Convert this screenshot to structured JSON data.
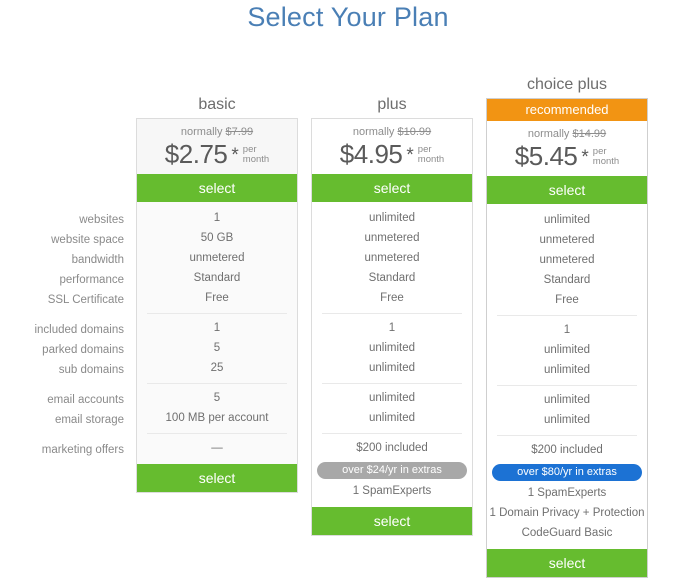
{
  "page": {
    "title": "Select Your Plan",
    "title_color": "#4a7fb5",
    "accent_green": "#66bc2f",
    "accent_orange": "#f29413",
    "accent_blue": "#1c72d4",
    "pill_gray": "#a8a8a8"
  },
  "feature_labels": {
    "group1": [
      "websites",
      "website space",
      "bandwidth",
      "performance",
      "SSL Certificate"
    ],
    "group2": [
      "included domains",
      "parked domains",
      "sub domains"
    ],
    "group3": [
      "email accounts",
      "email storage"
    ],
    "group4": [
      "marketing offers"
    ]
  },
  "plans": [
    {
      "name": "basic",
      "recommended_label": "",
      "is_recommended": false,
      "normally_prefix": "normally",
      "normally_price": "$7.99",
      "price": "$2.75",
      "star": "*",
      "per": "per",
      "month": "month",
      "select_label": "select",
      "values_group1": [
        "1",
        "50 GB",
        "unmetered",
        "Standard",
        "Free"
      ],
      "values_group2": [
        "1",
        "5",
        "25"
      ],
      "values_group3": [
        "5",
        "100 MB per account"
      ],
      "values_group4": [
        "—"
      ],
      "extras_pill": "",
      "extras": []
    },
    {
      "name": "plus",
      "recommended_label": "",
      "is_recommended": false,
      "normally_prefix": "normally",
      "normally_price": "$10.99",
      "price": "$4.95",
      "star": "*",
      "per": "per",
      "month": "month",
      "select_label": "select",
      "values_group1": [
        "unlimited",
        "unmetered",
        "unmetered",
        "Standard",
        "Free"
      ],
      "values_group2": [
        "1",
        "unlimited",
        "unlimited"
      ],
      "values_group3": [
        "unlimited",
        "unlimited"
      ],
      "values_group4": [
        "$200 included"
      ],
      "extras_pill": "over $24/yr in extras",
      "extras": [
        "1 SpamExperts"
      ]
    },
    {
      "name": "choice plus",
      "recommended_label": "recommended",
      "is_recommended": true,
      "normally_prefix": "normally",
      "normally_price": "$14.99",
      "price": "$5.45",
      "star": "*",
      "per": "per",
      "month": "month",
      "select_label": "select",
      "values_group1": [
        "unlimited",
        "unmetered",
        "unmetered",
        "Standard",
        "Free"
      ],
      "values_group2": [
        "1",
        "unlimited",
        "unlimited"
      ],
      "values_group3": [
        "unlimited",
        "unlimited"
      ],
      "values_group4": [
        "$200 included"
      ],
      "extras_pill": "over $80/yr in extras",
      "extras": [
        "1 SpamExperts",
        "1 Domain Privacy + Protection",
        "CodeGuard Basic"
      ]
    }
  ]
}
